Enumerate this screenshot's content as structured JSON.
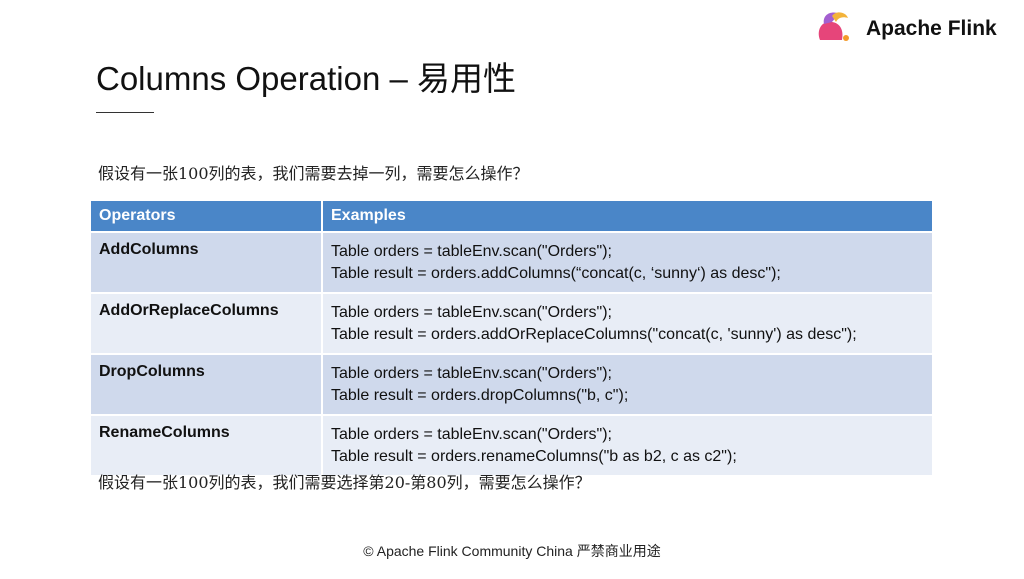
{
  "logo": {
    "name": "Apache Flink"
  },
  "title": "Columns Operation – 易用性",
  "question1": "假设有一张100列的表，我们需要去掉一列，需要怎么操作？",
  "question2": "假设有一张100列的表，我们需要选择第20-第80列，需要怎么操作？",
  "table": {
    "headers": [
      "Operators",
      "Examples"
    ],
    "rows": [
      {
        "op": "AddColumns",
        "line1": "Table orders = tableEnv.scan(\"Orders\");",
        "line2": "Table result = orders.addColumns(“concat(c, ‘sunny‘) as desc\");"
      },
      {
        "op": "AddOrReplaceColumns",
        "line1": "Table orders = tableEnv.scan(\"Orders\");",
        "line2": "Table result = orders.addOrReplaceColumns(\"concat(c, 'sunny') as desc\");"
      },
      {
        "op": "DropColumns",
        "line1": "Table orders = tableEnv.scan(\"Orders\");",
        "line2": "Table result = orders.dropColumns(\"b, c\");"
      },
      {
        "op": "RenameColumns",
        "line1": "Table orders = tableEnv.scan(\"Orders\");",
        "line2": "Table result = orders.renameColumns(\"b as b2, c as c2\");"
      }
    ]
  },
  "footer": "© Apache Flink Community China  严禁商业用途"
}
